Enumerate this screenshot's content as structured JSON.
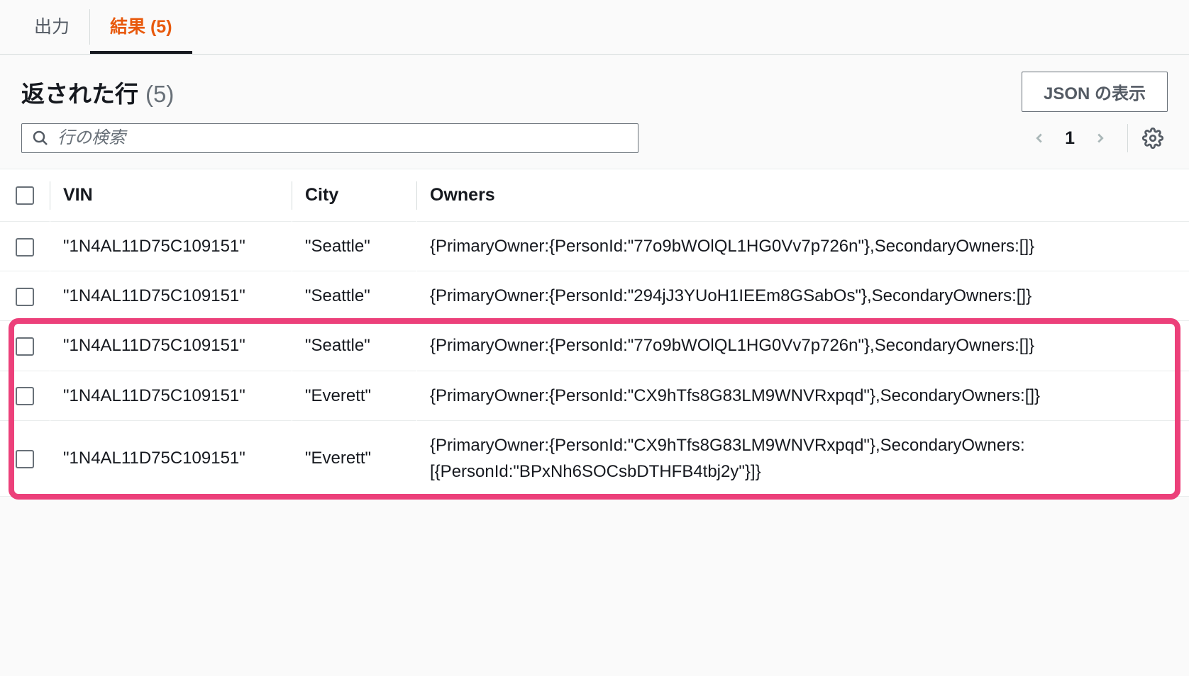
{
  "tabs": {
    "output": "出力",
    "results": "結果 (5)"
  },
  "header": {
    "title": "返された行",
    "count": "(5)",
    "json_button": "JSON の表示"
  },
  "search": {
    "placeholder": "行の検索"
  },
  "pager": {
    "page": "1"
  },
  "columns": {
    "vin": "VIN",
    "city": "City",
    "owners": "Owners"
  },
  "rows": [
    {
      "vin": "\"1N4AL11D75C109151\"",
      "city": "\"Seattle\"",
      "owners": "{PrimaryOwner:{PersonId:\"77o9bWOlQL1HG0Vv7p726n\"},SecondaryOwners:[]}",
      "highlighted": false
    },
    {
      "vin": "\"1N4AL11D75C109151\"",
      "city": "\"Seattle\"",
      "owners": "{PrimaryOwner:{PersonId:\"294jJ3YUoH1IEEm8GSabOs\"},SecondaryOwners:[]}",
      "highlighted": false
    },
    {
      "vin": "\"1N4AL11D75C109151\"",
      "city": "\"Seattle\"",
      "owners": "{PrimaryOwner:{PersonId:\"77o9bWOlQL1HG0Vv7p726n\"},SecondaryOwners:[]}",
      "highlighted": true
    },
    {
      "vin": "\"1N4AL11D75C109151\"",
      "city": "\"Everett\"",
      "owners": "{PrimaryOwner:{PersonId:\"CX9hTfs8G83LM9WNVRxpqd\"},SecondaryOwners:[]}",
      "highlighted": true
    },
    {
      "vin": "\"1N4AL11D75C109151\"",
      "city": "\"Everett\"",
      "owners": "{PrimaryOwner:{PersonId:\"CX9hTfs8G83LM9WNVRxpqd\"},SecondaryOwners:[{PersonId:\"BPxNh6SOCsbDTHFB4tbj2y\"}]}",
      "highlighted": true
    }
  ]
}
